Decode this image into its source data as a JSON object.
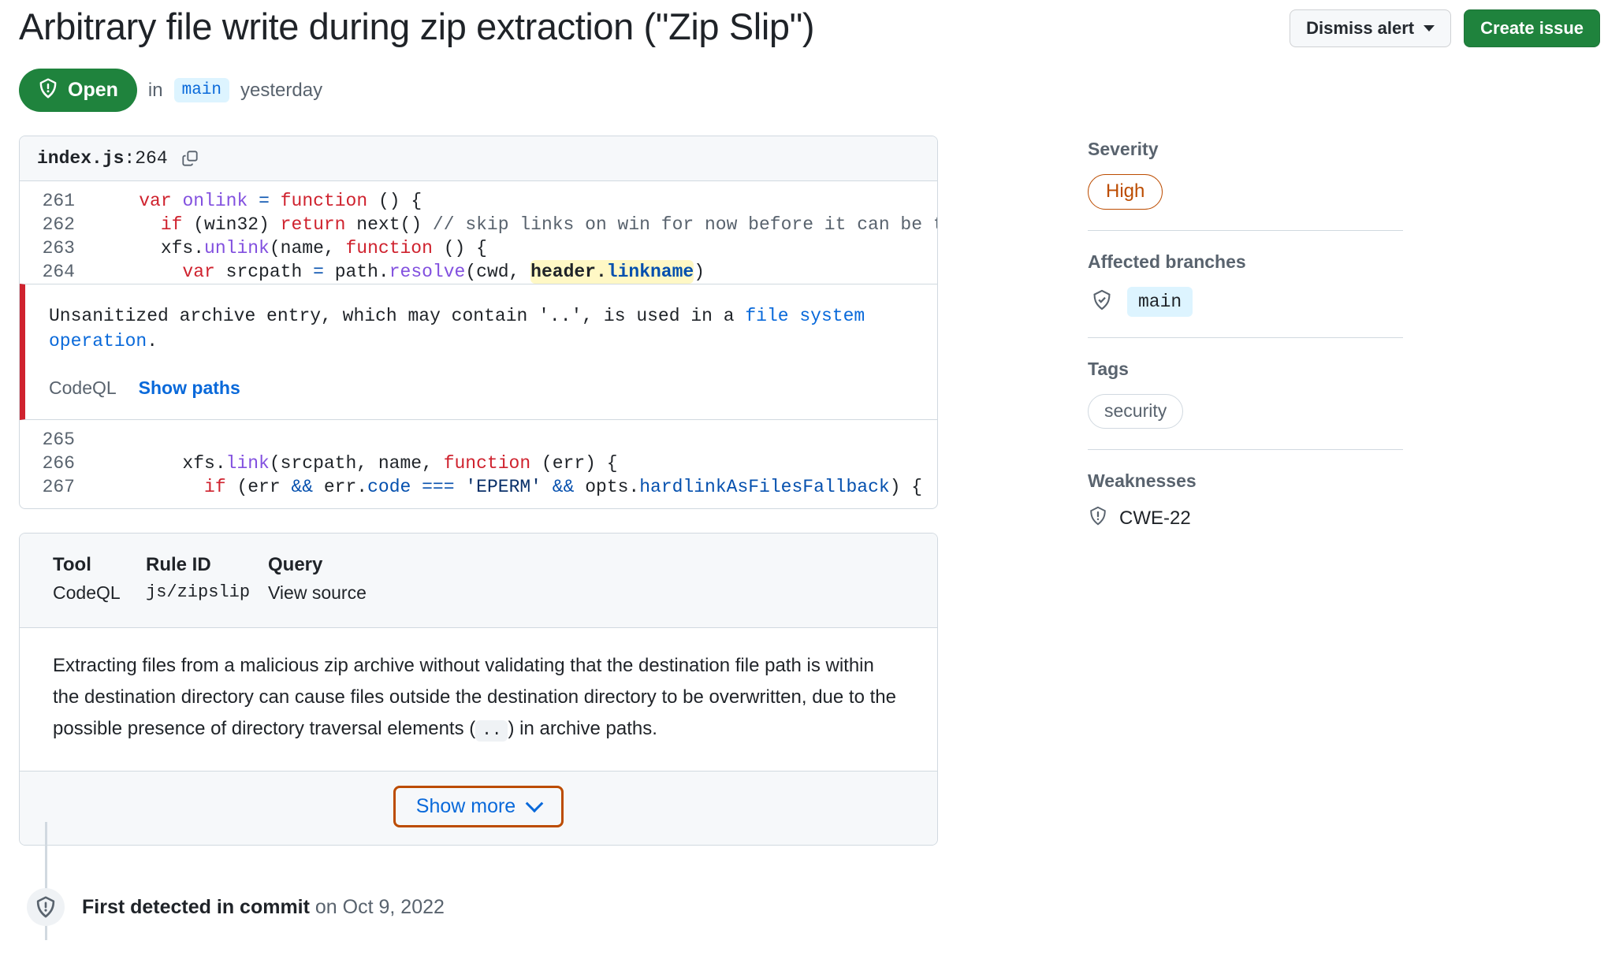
{
  "header": {
    "title": "Arbitrary file write during zip extraction (\"Zip Slip\")",
    "dismiss_label": "Dismiss alert",
    "create_issue_label": "Create issue"
  },
  "state": {
    "badge_label": "Open",
    "in_label": "in",
    "branch": "main",
    "time": "yesterday"
  },
  "code": {
    "file_label_name": "index.js",
    "file_label_line": ":264",
    "lines_top": [
      {
        "num": "261",
        "html": "    <span class=\"tok-kw\">var</span> <span class=\"tok-fn\">onlink</span> <span class=\"tok-op\">=</span> <span class=\"tok-kw\">function</span> () {"
      },
      {
        "num": "262",
        "html": "      <span class=\"tok-kw\">if</span> (win32) <span class=\"tok-kw\">return</span> next() <span class=\"tok-com\">// skip links on win for now before it can be tested</span>"
      },
      {
        "num": "263",
        "html": "      xfs.<span class=\"tok-fn\">unlink</span>(name, <span class=\"tok-kw\">function</span> () {"
      },
      {
        "num": "264",
        "html": "        <span class=\"tok-kw\">var</span> srcpath <span class=\"tok-op\">=</span> path.<span class=\"tok-fn\">resolve</span>(cwd, <span class=\"hl\">header.<span class=\"tok-prop\">linkname</span></span>)"
      }
    ],
    "lines_bottom": [
      {
        "num": "265",
        "html": ""
      },
      {
        "num": "266",
        "html": "        xfs.<span class=\"tok-fn\">link</span>(srcpath, name, <span class=\"tok-kw\">function</span> (err) {"
      },
      {
        "num": "267",
        "html": "          <span class=\"tok-kw\">if</span> (err <span class=\"tok-op\">&amp;&amp;</span> err.<span class=\"tok-prop\">code</span> <span class=\"tok-op\">===</span> <span class=\"tok-str\">'EPERM'</span> <span class=\"tok-op\">&amp;&amp;</span> opts.<span class=\"tok-prop\">hardlinkAsFilesFallback</span>) {"
      }
    ]
  },
  "alert": {
    "message_pre": "Unsanitized archive entry, which may contain '..', is used in a ",
    "message_link": "file system operation",
    "message_post": ".",
    "tool": "CodeQL",
    "show_paths": "Show paths"
  },
  "details": {
    "columns": [
      {
        "header": "Tool",
        "value": "CodeQL",
        "mono": false
      },
      {
        "header": "Rule ID",
        "value": "js/zipslip",
        "mono": true
      },
      {
        "header": "Query",
        "value": "View source",
        "mono": false
      }
    ],
    "description_part1": "Extracting files from a malicious zip archive without validating that the destination file path is within the destination directory can cause files outside the destination directory to be overwritten, due to the possible presence of directory traversal elements (",
    "description_code": "..",
    "description_part2": ") in archive paths.",
    "show_more_label": "Show more"
  },
  "timeline": {
    "event_bold": "First detected in commit",
    "event_rest": " on Oct 9, 2022"
  },
  "sidebar": {
    "severity_heading": "Severity",
    "severity_value": "High",
    "branches_heading": "Affected branches",
    "branch_value": "main",
    "tags_heading": "Tags",
    "tag_value": "security",
    "weaknesses_heading": "Weaknesses",
    "weakness_value": "CWE-22"
  },
  "colors": {
    "open_green": "#1f833d",
    "severity_orange": "#bc4c00",
    "link_blue": "#0969da",
    "alert_red": "#cf222e",
    "highlight_yellow": "#fff8c5"
  }
}
